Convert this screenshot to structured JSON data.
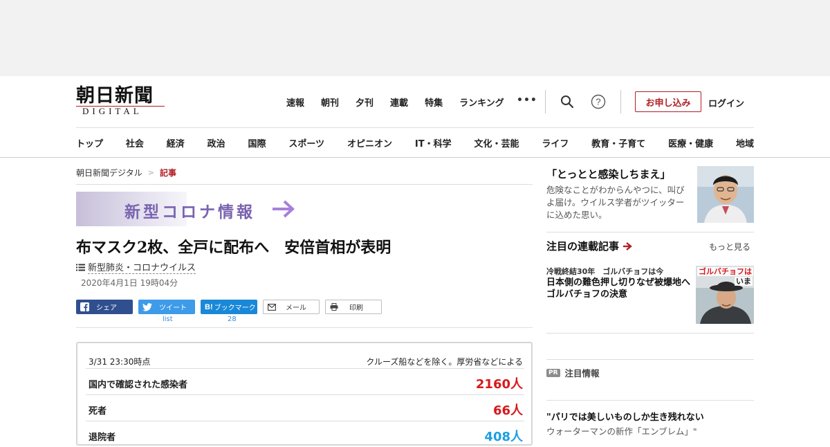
{
  "header": {
    "logo_jp": "朝日新聞",
    "logo_en": "DIGITAL",
    "main_nav": [
      "速報",
      "朝刊",
      "夕刊",
      "連載",
      "特集",
      "ランキング"
    ],
    "more": "•••",
    "subscribe_label": "お申し込み",
    "login_label": "ログイン",
    "categories": [
      "トップ",
      "社会",
      "経済",
      "政治",
      "国際",
      "スポーツ",
      "オピニオン",
      "IT・科学",
      "文化・芸能",
      "ライフ",
      "教育・子育て",
      "医療・健康",
      "地域"
    ]
  },
  "breadcrumb": {
    "home": "朝日新聞デジタル",
    "separator": ">",
    "current": "記事"
  },
  "banner": {
    "text": "新型コロナ情報"
  },
  "article": {
    "headline": "布マスク2枚、全戸に配布へ　安倍首相が表明",
    "tag": "新型肺炎・コロナウイルス",
    "date": "2020年4月1日 19時04分"
  },
  "share": {
    "facebook": "シェア",
    "twitter": "ツイート",
    "twitter_count": "list",
    "hatena": "ブックマーク",
    "hatena_count": "28",
    "mail": "メール",
    "print": "印刷"
  },
  "stats": {
    "asof": "3/31 23:30時点",
    "note": "クルーズ船などを除く。厚労省などによる",
    "rows": [
      {
        "label": "国内で確認された感染者",
        "value": "2160人",
        "color": "#d7191c"
      },
      {
        "label": "死者",
        "value": "66人",
        "color": "#d7191c"
      },
      {
        "label": "退院者",
        "value": "408人",
        "color": "#1aa0e0"
      }
    ]
  },
  "sidebar": {
    "feature": {
      "title": "「とっとと感染しちまえ」",
      "desc": "危険なことがわからんやつに、叫びよ届け。ウイルス学者がツイッターに込めた思い。"
    },
    "series": {
      "title": "注目の連載記事",
      "more": "もっと見る",
      "kicker": "冷戦終結30年　ゴルバチョフは今",
      "headline": "日本側の難色押し切りなぜ被爆地へ　ゴルバチョフの決意",
      "photo_caption_1": "ゴルバチョフは",
      "photo_caption_2": "いま"
    },
    "pr": {
      "badge": "PR",
      "label": "注目情報",
      "headline": "\"パリでは美しいものしか生き残れない",
      "sub": "ウォーターマンの新作「エンブレム」\""
    }
  },
  "colors": {
    "brand_red": "#b01f24",
    "facebook": "#2f4f8f",
    "twitter": "#3d9be9",
    "hatena": "#1a88d8"
  }
}
